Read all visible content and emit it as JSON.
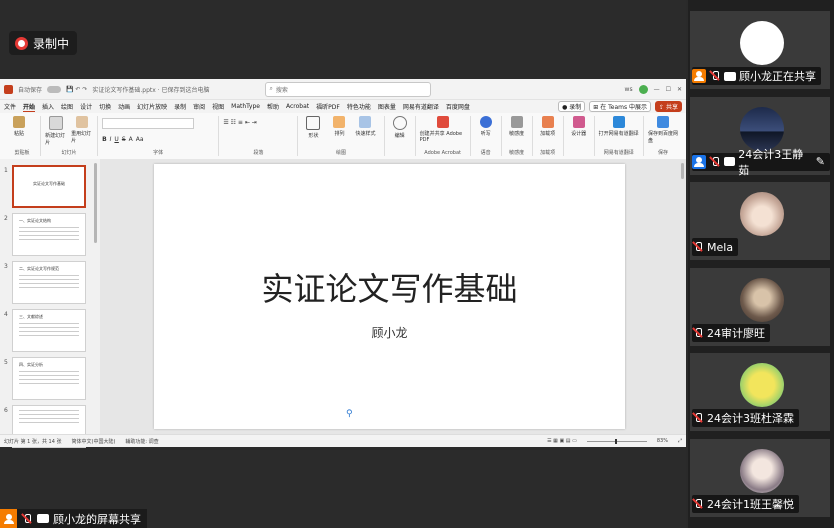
{
  "recording": {
    "label": "录制中"
  },
  "ppt": {
    "autosave": "自动保存",
    "doc_title": "实证论文写作基础.pptx · 已保存到这台电脑",
    "search_placeholder": "搜索",
    "user_initial": "ws",
    "menu": [
      "文件",
      "开始",
      "插入",
      "绘图",
      "设计",
      "切换",
      "动画",
      "幻灯片放映",
      "录制",
      "审阅",
      "视图",
      "MathType",
      "帮助",
      "Acrobat",
      "福昕PDF",
      "特色功能",
      "图表量",
      "网易有道翻译",
      "百度网盘"
    ],
    "menu_active": "开始",
    "menu_right": {
      "record": "录制",
      "teams": "在 Teams 中展示",
      "share": "共享"
    },
    "ribbon_groups": [
      {
        "label": "剪贴板",
        "buttons": [
          "粘贴"
        ]
      },
      {
        "label": "幻灯片",
        "buttons": [
          "新建幻灯片",
          "重用幻灯片"
        ]
      },
      {
        "label": "字体",
        "buttons": []
      },
      {
        "label": "段落",
        "buttons": []
      },
      {
        "label": "绘图",
        "buttons": [
          "形状",
          "排列",
          "快速样式"
        ]
      },
      {
        "label": "编辑",
        "buttons": [
          "编辑"
        ]
      },
      {
        "label": "Adobe Acrobat",
        "buttons": [
          "创建并共享 Adobe PDF"
        ]
      },
      {
        "label": "语音",
        "buttons": [
          "听写"
        ]
      },
      {
        "label": "敏感度",
        "buttons": [
          "敏感度"
        ]
      },
      {
        "label": "加载项",
        "buttons": [
          "加载项"
        ]
      },
      {
        "label": "",
        "buttons": [
          "设计器"
        ]
      },
      {
        "label": "网易有道翻译",
        "buttons": [
          "打开网易有道翻译"
        ]
      },
      {
        "label": "保存",
        "buttons": [
          "保存到百度网盘"
        ]
      }
    ],
    "thumbs": [
      {
        "num": "1",
        "title": "实证论文写作基础"
      },
      {
        "num": "2",
        "title": "一、实证论文结构"
      },
      {
        "num": "3",
        "title": "二、实证论文写作规范"
      },
      {
        "num": "4",
        "title": "三、文献综述"
      },
      {
        "num": "5",
        "title": "四、实证分析"
      },
      {
        "num": "6",
        "title": ""
      }
    ],
    "slide": {
      "title": "实证论文写作基础",
      "subtitle": "顾小龙"
    },
    "status": {
      "slide_info": "幻灯片 第 1 张，共 14 张",
      "language": "简体中文(中国大陆)",
      "accessibility": "辅助功能: 调查",
      "zoom": "83%"
    }
  },
  "presenter": {
    "label": "顾小龙的屏幕共享"
  },
  "participants": [
    {
      "name": "顾小龙正在共享",
      "avatar": "white-circle",
      "badge": "orange"
    },
    {
      "name": "24会计3王静茹",
      "avatar": "night-lake",
      "badge": "blue",
      "extra": "pencil"
    },
    {
      "name": "Mela",
      "avatar": "kitten"
    },
    {
      "name": "24审计廖旺",
      "avatar": "portrait"
    },
    {
      "name": "24会计3班杜泽霖",
      "avatar": "cartoon"
    },
    {
      "name": "24会计1班王馨悦",
      "avatar": "girl"
    }
  ]
}
